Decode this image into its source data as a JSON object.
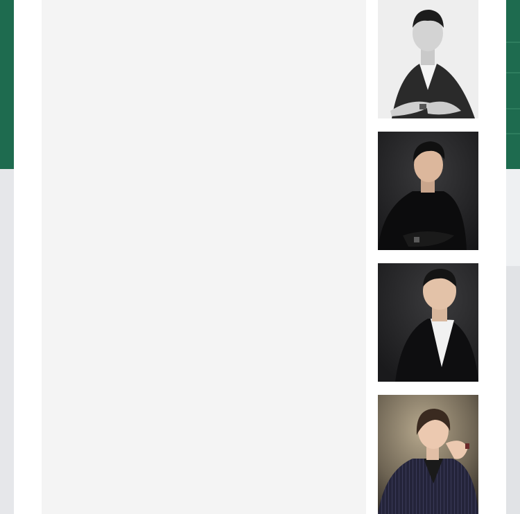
{
  "page": {
    "accent_green": "#1e6b4f",
    "panel_background": "#f4f4f4"
  },
  "team_portraits": [
    {
      "image": "portrait-man-white-shirt-grayscale"
    },
    {
      "image": "portrait-man-black-shirt"
    },
    {
      "image": "portrait-man-black-suit"
    },
    {
      "image": "portrait-woman-pinstripe-suit"
    }
  ]
}
